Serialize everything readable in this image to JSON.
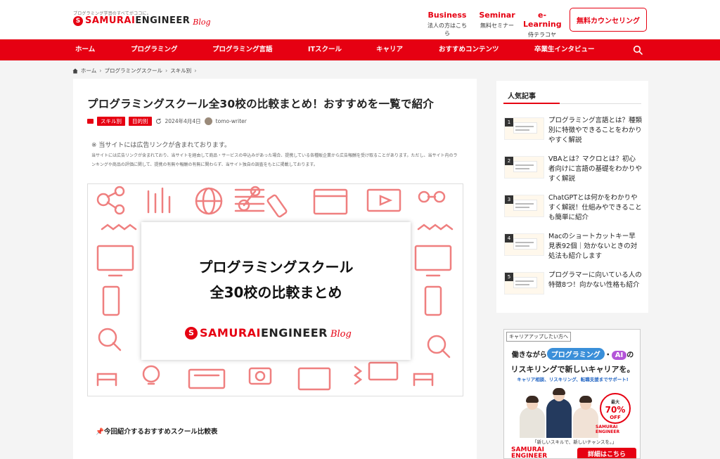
{
  "header": {
    "tagline": "プログラミング学習のすべてがココに。",
    "logo_samurai": "SAMURAI",
    "logo_engineer": "ENGINEER",
    "logo_blog": "Blog",
    "links": [
      {
        "en": "Business",
        "ja": "法人の方はこちら"
      },
      {
        "en": "Seminar",
        "ja": "無料セミナー"
      },
      {
        "en": "e-Learning",
        "ja": "侍テラコヤ"
      }
    ],
    "cta": "無料カウンセリング"
  },
  "nav": {
    "items": [
      "ホーム",
      "プログラミング",
      "プログラミング言語",
      "ITスクール",
      "キャリア",
      "おすすめコンテンツ",
      "卒業生インタビュー"
    ],
    "search_icon": "search-icon"
  },
  "breadcrumb": {
    "items": [
      "ホーム",
      "プログラミングスクール",
      "スキル別"
    ]
  },
  "article": {
    "title": "プログラミングスクール全30校の比較まとめ！おすすめを一覧で紹介",
    "tags": [
      "スキル別",
      "目的別"
    ],
    "date": "2024年4月4日",
    "author": "tomo-writer",
    "notice": "※ 当サイトには広告リンクが含まれております。",
    "disclaimer": "当サイトには広告リンクが含まれており、当サイトを経由して商品・サービスの申込みがあった場合、提携している各種販企業から広告報酬を受け取ることがあります。ただし、当サイト内のランキングや商品の評価に関して、提携の有無や報酬の有無に関わらず、当サイト独自の調査をもとに掲載しております。",
    "hero_line1": "プログラミングスクール",
    "hero_line2": "全30校の比較まとめ",
    "subheading": "今回紹介するおすすめスクール比較表"
  },
  "sidebar": {
    "popular_heading": "人気記事",
    "popular": [
      {
        "rank": "1",
        "title": "プログラミング言語とは？種類別に特徴やできることをわかりやすく解説"
      },
      {
        "rank": "2",
        "title": "VBAとは？マクロとは？初心者向けに言語の基礎をわかりやすく解説"
      },
      {
        "rank": "3",
        "title": "ChatGPTとは何かをわかりやすく解説！仕組みやできることも簡単に紹介"
      },
      {
        "rank": "4",
        "title": "Macのショートカットキー早見表92個｜効かないときの対処法も紹介します"
      },
      {
        "rank": "5",
        "title": "プログラマーに向いている人の特徴8つ！向かない性格も紹介"
      }
    ]
  },
  "ad": {
    "top_label": "キャリアアップしたい方へ",
    "line1_a": "働きながら",
    "line1_pill1": "プログラミング",
    "line1_dot": "・",
    "line1_pill2": "AI",
    "line1_b": "の",
    "line2": "リスキリングで新しいキャリアを。",
    "line3": "キャリア相談、リスキリング、転職支援までサポート!",
    "discount_small": "最大",
    "discount_num": "70%",
    "discount_off": "OFF",
    "brand": "SAMURAI ENGINEER",
    "slogan": "「新しいスキルで、新しいチャンスを。」",
    "logo_line1": "SAMURAI",
    "logo_line2": "ENGINEER",
    "button": "詳細はこちら"
  },
  "colors": {
    "brand_red": "#e60012",
    "pill_blue": "#3a8fd9",
    "pill_purple": "#b455d8"
  }
}
